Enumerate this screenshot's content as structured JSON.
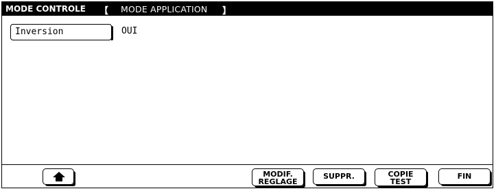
{
  "header": {
    "mode_label": "MODE CONTROLE",
    "bracket_left": "【",
    "submode_label": "MODE APPLICATION",
    "bracket_right": "】"
  },
  "setting": {
    "name": "Inversion",
    "value": "OUI"
  },
  "buttons": {
    "home_icon": "home-up-arrow-icon",
    "modif_line1": "MODIF.",
    "modif_line2": "REGLAGE",
    "suppr": "SUPPR.",
    "copie_line1": "COPIE",
    "copie_line2": "TEST",
    "fin": "FIN"
  }
}
